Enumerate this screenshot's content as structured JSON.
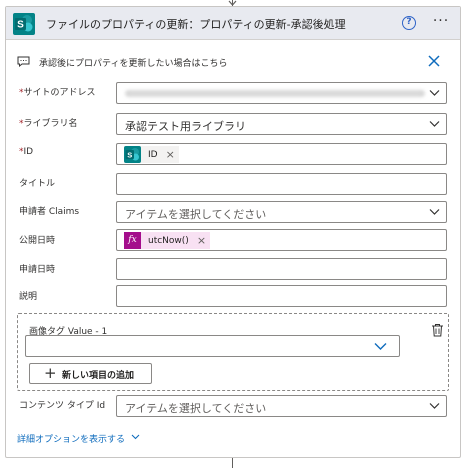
{
  "header": {
    "title": "ファイルのプロパティの更新：プロパティの更新-承認後処理",
    "help_glyph": "?",
    "more_glyph": "···"
  },
  "comment": {
    "text": "承認後にプロパティを更新したい場合はこちら"
  },
  "fields": {
    "site": {
      "label": "サイトのアドレス",
      "required": true
    },
    "library": {
      "label": "ライブラリ名",
      "required": true,
      "value": "承認テスト用ライブラリ"
    },
    "id": {
      "label": "ID",
      "required": true,
      "token": "ID"
    },
    "title": {
      "label": "タイトル"
    },
    "claims": {
      "label": "申請者 Claims",
      "placeholder": "アイテムを選択してください"
    },
    "publish_date": {
      "label": "公開日時",
      "token": "utcNow()",
      "token_glyph": "fx"
    },
    "request_date": {
      "label": "申請日時"
    },
    "description": {
      "label": "説明"
    },
    "image_tag": {
      "label": "画像タグ Value - 1",
      "add_label": "新しい項目の追加",
      "add_glyph": "+"
    },
    "content_type": {
      "label": "コンテンツ タイプ Id",
      "placeholder": "アイテムを選択してください"
    }
  },
  "required_mark": "*",
  "token_remove_glyph": "×",
  "advanced": {
    "label": "詳細オプションを表示する"
  },
  "colors": {
    "header_bg": "#e8eaf0",
    "sharepoint": "#038387",
    "fx_token": "#a40e8c",
    "link": "#0f6cbd",
    "required": "#a4262c"
  },
  "icons": [
    "sharepoint-icon",
    "help-icon",
    "more-icon",
    "comment-icon",
    "close-icon",
    "chevron-down-icon",
    "trash-icon",
    "plus-icon",
    "fx-icon"
  ]
}
